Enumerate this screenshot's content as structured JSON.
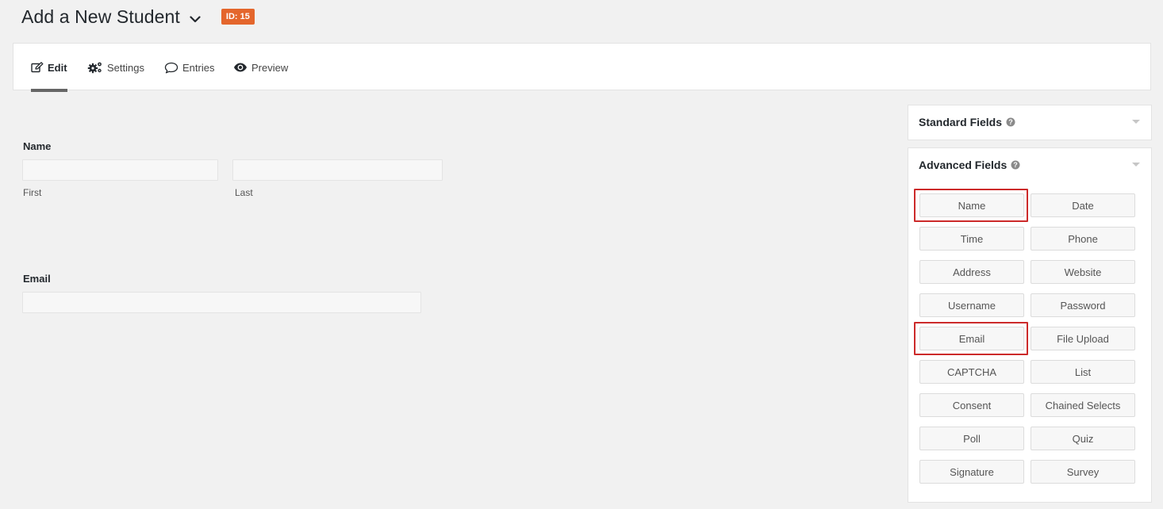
{
  "header": {
    "title": "Add a New Student",
    "id_badge": "ID: 15",
    "badge_color": "#e4662c"
  },
  "tabs": [
    {
      "label": "Edit",
      "icon": "edit-icon",
      "active": true
    },
    {
      "label": "Settings",
      "icon": "gears-icon",
      "active": false
    },
    {
      "label": "Entries",
      "icon": "comment-icon",
      "active": false
    },
    {
      "label": "Preview",
      "icon": "eye-icon",
      "active": false
    }
  ],
  "form": {
    "name_field": {
      "label": "Name",
      "first_sublabel": "First",
      "last_sublabel": "Last",
      "first_value": "",
      "last_value": ""
    },
    "email_field": {
      "label": "Email",
      "value": ""
    }
  },
  "sidebar": {
    "standard_fields": {
      "title": "Standard Fields",
      "icon": "help-icon",
      "collapsed": true
    },
    "advanced_fields": {
      "title": "Advanced Fields",
      "icon": "help-icon",
      "highlight_color": "#cc2a2a",
      "buttons": [
        {
          "label": "Name",
          "highlighted": true
        },
        {
          "label": "Date",
          "highlighted": false
        },
        {
          "label": "Time",
          "highlighted": false
        },
        {
          "label": "Phone",
          "highlighted": false
        },
        {
          "label": "Address",
          "highlighted": false
        },
        {
          "label": "Website",
          "highlighted": false
        },
        {
          "label": "Username",
          "highlighted": false
        },
        {
          "label": "Password",
          "highlighted": false
        },
        {
          "label": "Email",
          "highlighted": true
        },
        {
          "label": "File Upload",
          "highlighted": false
        },
        {
          "label": "CAPTCHA",
          "highlighted": false
        },
        {
          "label": "List",
          "highlighted": false
        },
        {
          "label": "Consent",
          "highlighted": false
        },
        {
          "label": "Chained Selects",
          "highlighted": false
        },
        {
          "label": "Poll",
          "highlighted": false
        },
        {
          "label": "Quiz",
          "highlighted": false
        },
        {
          "label": "Signature",
          "highlighted": false
        },
        {
          "label": "Survey",
          "highlighted": false
        }
      ]
    }
  }
}
